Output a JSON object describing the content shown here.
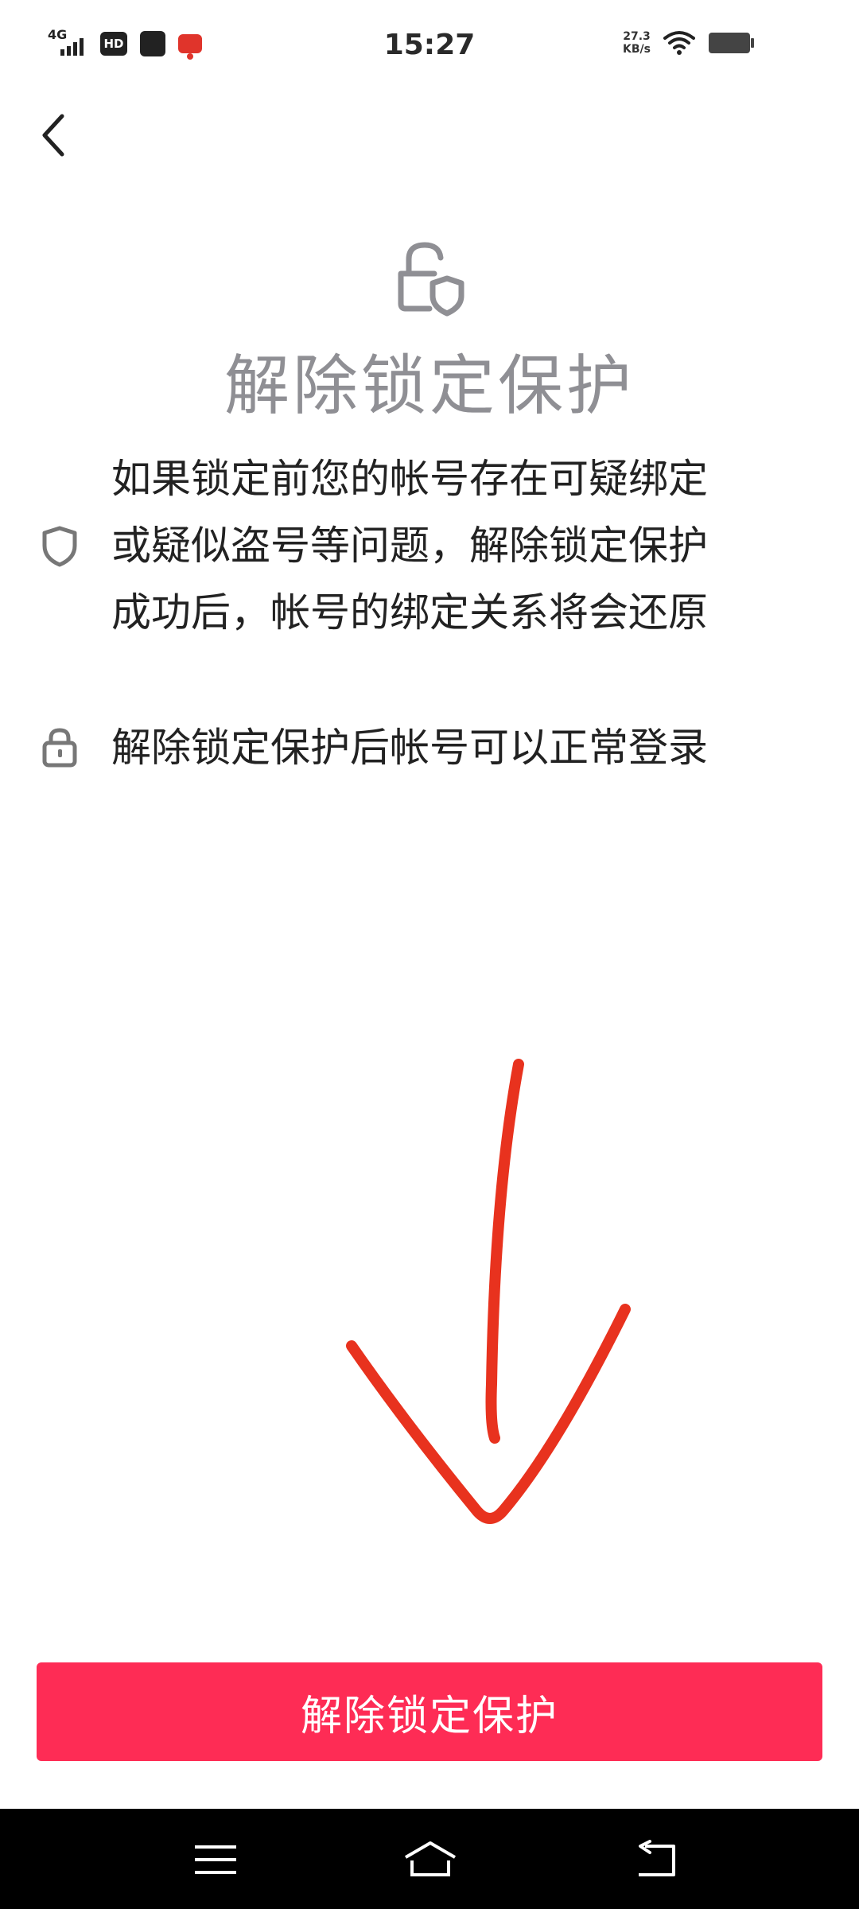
{
  "status_bar": {
    "network": "4G",
    "hd_badge": "HD",
    "time": "15:27",
    "net_speed_value": "27.3",
    "net_speed_unit": "KB/s",
    "icons": [
      "signal-icon",
      "hd-icon",
      "app-icon",
      "app-icon",
      "wifi-icon",
      "battery-icon"
    ]
  },
  "header": {
    "back_icon": "back-chevron-icon",
    "hero_icon": "unlock-shield-icon",
    "title": "解除锁定保护"
  },
  "info_items": [
    {
      "icon": "shield-icon",
      "lines": [
        "如果锁定前您的帐号存在可疑绑定",
        "或疑似盗号等问题，解除锁定保护",
        "成功后，帐号的绑定关系将会还原"
      ]
    },
    {
      "icon": "lock-icon",
      "lines": [
        "解除锁定保护后帐号可以正常登录"
      ]
    }
  ],
  "annotation": {
    "icon": "down-arrow-annotation",
    "color": "#e8321e"
  },
  "actions": {
    "primary_label": "解除锁定保护",
    "primary_color": "#fe2c55"
  },
  "nav_bar": {
    "icons": [
      "menu-icon",
      "home-icon",
      "back-icon"
    ]
  }
}
